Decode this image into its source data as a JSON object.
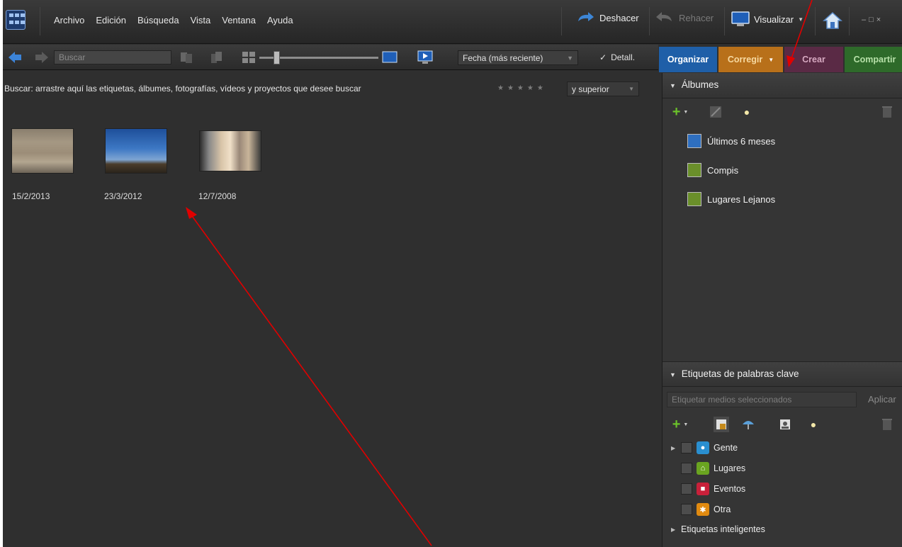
{
  "menubar": {
    "items": [
      "Archivo",
      "Edición",
      "Búsqueda",
      "Vista",
      "Ventana",
      "Ayuda"
    ],
    "undo_label": "Deshacer",
    "redo_label": "Rehacer",
    "view_label": "Visualizar"
  },
  "toolbar": {
    "search_placeholder": "Buscar",
    "sort_label": "Fecha (más reciente)",
    "details_label": "Detall."
  },
  "tabs": {
    "organize": "Organizar",
    "fix": "Corregir",
    "create": "Crear",
    "share": "Compartir"
  },
  "content": {
    "hint": "Buscar:  arrastre aquí las etiquetas, álbumes, fotografías, vídeos y proyectos que desee buscar",
    "rating_filter": "y superior",
    "photos": [
      {
        "date": "15/2/2013"
      },
      {
        "date": "23/3/2012"
      },
      {
        "date": "12/7/2008"
      }
    ]
  },
  "albums_panel": {
    "title": "Álbumes",
    "albums": [
      {
        "name": "Últimos 6 meses",
        "color": "#2e6fc0"
      },
      {
        "name": "Compis",
        "color": "#6a8f2a"
      },
      {
        "name": "Lugares Lejanos",
        "color": "#6a8f2a"
      }
    ]
  },
  "keywords_panel": {
    "title": "Etiquetas de palabras clave",
    "input_placeholder": "Etiquetar medios seleccionados",
    "apply_label": "Aplicar",
    "categories": [
      {
        "name": "Gente",
        "color": "#2a8fd0",
        "icon": "person-icon"
      },
      {
        "name": "Lugares",
        "color": "#6aa420",
        "icon": "places-icon"
      },
      {
        "name": "Eventos",
        "color": "#c8203a",
        "icon": "events-icon"
      },
      {
        "name": "Otra",
        "color": "#e08a10",
        "icon": "other-icon"
      }
    ],
    "smart_tags_label": "Etiquetas inteligentes"
  },
  "colors": {
    "tab_organize": "#1f5fa8",
    "tab_fix": "#b8701a",
    "tab_create": "#5a2a45",
    "tab_share": "#2e6a2a"
  }
}
